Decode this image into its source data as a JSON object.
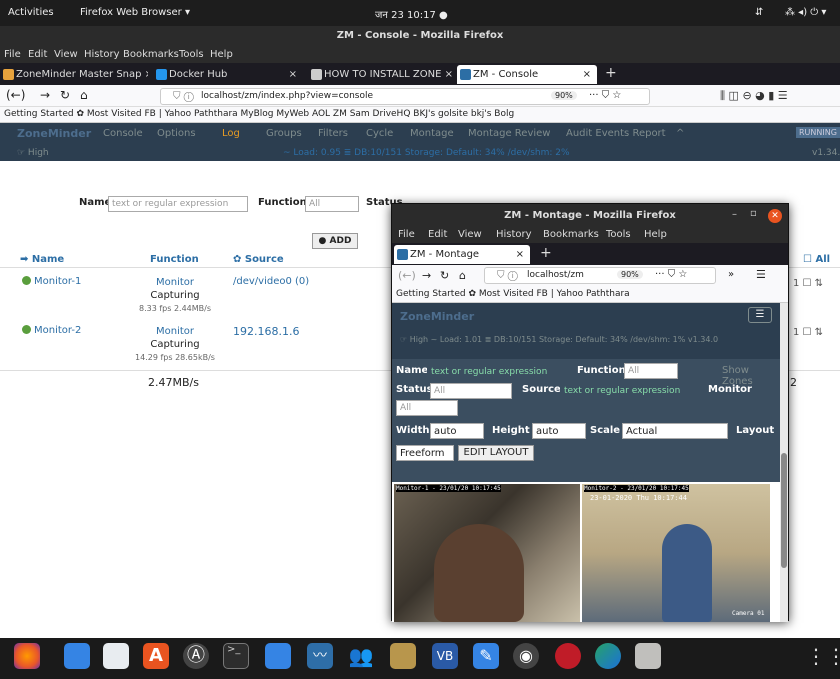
{
  "topbar": {
    "activities": "Activities",
    "app": "Firefox Web Browser ▾",
    "clock": "जन 23 10:17 ●"
  },
  "main_window": {
    "title": "ZM - Console - Mozilla Firefox",
    "menu": [
      "File",
      "Edit",
      "View",
      "History",
      "Bookmarks",
      "Tools",
      "Help"
    ],
    "tabs": [
      {
        "label": "ZoneMinder Master Snap ×",
        "color": "#e8a33d"
      },
      {
        "label": "Docker Hub",
        "color": "#2496ed"
      },
      {
        "label": "HOW TO INSTALL ZONE ×",
        "color": "#444444"
      },
      {
        "label": "ZM - Console",
        "color": "#2c6ea5",
        "active": true
      }
    ],
    "url": "localhost/zm/index.php?view=console",
    "zoom": "90%",
    "bookmarks": "Getting Started  ✿ Most Visited  FB | Yahoo  Paththara  MyBlog  MyWeb  AOL  ZM  Sam  DriveHQ  BKJ's golsite  bkj's Bolg"
  },
  "zm": {
    "brand": "ZoneMinder",
    "nav": [
      "Console",
      "Options",
      "Log",
      "Groups",
      "Filters",
      "Cycle",
      "Montage",
      "Montage Review",
      "Audit Events Report",
      "^"
    ],
    "running": "RUNNING",
    "status_left": "☞ High",
    "status_mid": "~ Load: 0.95  ≣  DB:10/151   Storage: Default: 34% /dev/shm: 2%",
    "version": "v1.34.0",
    "filters": {
      "name_label": "Name",
      "name_placeholder": "text or regular expression",
      "function_label": "Function",
      "function_value": "All",
      "status_label": "Status",
      "status_value": "All"
    },
    "add_button": "● ADD",
    "columns": {
      "name": "➡ Name",
      "function": "Function",
      "source": "✿ Source",
      "all": "All"
    },
    "monitors": [
      {
        "name": "Monitor-1",
        "function": "Monitor",
        "state": "Capturing",
        "fps": "8.33 fps 2.44MB/s",
        "source": "/dev/video0 (0)"
      },
      {
        "name": "Monitor-2",
        "function": "Monitor",
        "state": "Capturing",
        "fps": "14.29 fps 28.65kB/s",
        "source": "192.168.1.6"
      }
    ],
    "total": "2.47MB/s",
    "right_count": "2"
  },
  "popup": {
    "title": "ZM - Montage - Mozilla Firefox",
    "menu": [
      "File",
      "Edit",
      "View",
      "History",
      "Bookmarks",
      "Tools",
      "Help"
    ],
    "tab": "ZM - Montage",
    "url": "localhost/zm",
    "zoom": "90%",
    "bookmarks": "Getting Started  ✿ Most Visited  FB | Yahoo  Paththara",
    "brand": "ZoneMinder",
    "status": "☞ High  ~ Load: 1.01  ≣  DB:10/151  Storage: Default: 34% /dev/shm: 1%   v1.34.0",
    "name_label": "Name",
    "name_placeholder": "text or regular expression",
    "function_label": "Function",
    "function_value": "All",
    "show_zones": "Show Zones",
    "status_label": "Status",
    "status_value": "All",
    "source_label": "Source",
    "source_placeholder": "text or regular expression",
    "monitor_label": "Monitor",
    "monitor_value": "All",
    "width_label": "Width",
    "width_value": "auto",
    "height_label": "Height",
    "height_value": "auto",
    "scale_label": "Scale",
    "scale_value": "Actual",
    "layout_label": "Layout",
    "layout_value": "Freeform",
    "edit_layout": "EDIT LAYOUT",
    "cam1_caption": "Monitor-1 - 23/01/20 10:17:45",
    "cam2_caption": "Monitor-2 - 23/01/20 10:17:45",
    "cam2_overlay": "23-01-2020 Thu 10:17:44",
    "cam2_corner": "Camera 01"
  }
}
